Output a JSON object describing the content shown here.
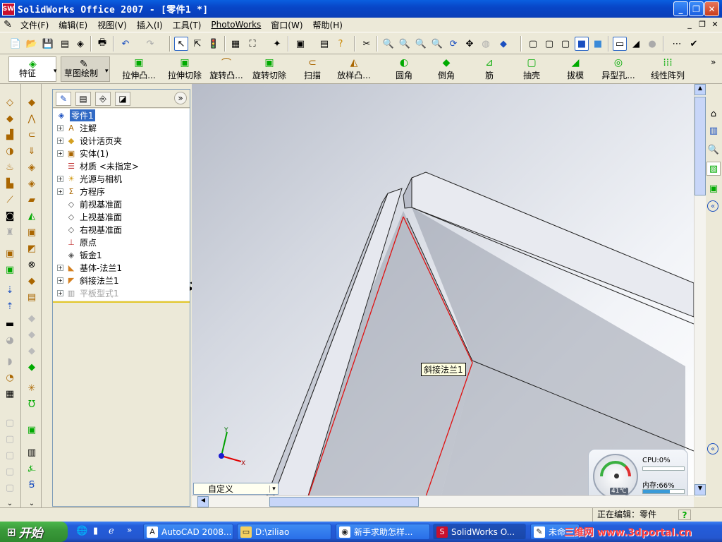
{
  "window": {
    "title": "SolidWorks Office 2007 - [零件1 *]",
    "app_icon": "SW"
  },
  "menu": [
    "文件(F)",
    "编辑(E)",
    "视图(V)",
    "插入(I)",
    "工具(T)",
    "PhotoWorks",
    "窗口(W)",
    "帮助(H)"
  ],
  "feature_toolbar": {
    "tabs": [
      "特征",
      "草图绘制"
    ],
    "items": [
      "拉伸凸...",
      "拉伸切除",
      "旋转凸...",
      "旋转切除",
      "扫描",
      "放样凸...",
      "圆角",
      "倒角",
      "筋",
      "抽壳",
      "拔模",
      "异型孔...",
      "线性阵列"
    ]
  },
  "feature_tree": {
    "root": "零件1",
    "items": [
      {
        "label": "注解",
        "icon": "annotation-icon",
        "expandable": true
      },
      {
        "label": "设计活页夹",
        "icon": "design-binder-icon",
        "expandable": true
      },
      {
        "label": "实体(1)",
        "icon": "solid-bodies-icon",
        "expandable": true
      },
      {
        "label": "材质 <未指定>",
        "icon": "material-icon",
        "expandable": false
      },
      {
        "label": "光源与相机",
        "icon": "lights-camera-icon",
        "expandable": true
      },
      {
        "label": "方程序",
        "icon": "equations-icon",
        "expandable": true
      },
      {
        "label": "前视基准面",
        "icon": "plane-icon",
        "expandable": false
      },
      {
        "label": "上视基准面",
        "icon": "plane-icon",
        "expandable": false
      },
      {
        "label": "右视基准面",
        "icon": "plane-icon",
        "expandable": false
      },
      {
        "label": "原点",
        "icon": "origin-icon",
        "expandable": false
      },
      {
        "label": "钣金1",
        "icon": "sheet-metal-icon",
        "expandable": false
      },
      {
        "label": "基体-法兰1",
        "icon": "base-flange-icon",
        "expandable": true
      },
      {
        "label": "斜接法兰1",
        "icon": "miter-flange-icon",
        "expandable": true
      },
      {
        "label": "平板型式1",
        "icon": "flat-pattern-icon",
        "expandable": true,
        "suppressed": true
      }
    ]
  },
  "graphics": {
    "callout": "斜接法兰1",
    "view_select": "自定义",
    "triad": {
      "x": "X",
      "y": "Y"
    }
  },
  "widget": {
    "cpu": "CPU:0%",
    "memory": "内存:66%",
    "memory_fraction": 0.66,
    "temp": "41℃"
  },
  "status": {
    "editing": "正在编辑：零件",
    "help": "?"
  },
  "taskbar": {
    "start": "开始",
    "tasks": [
      "AutoCAD 2008...",
      "D:\\ziliao",
      "新手求助怎样...",
      "SolidWorks O...",
      "未命"
    ],
    "watermark": "三维网 www.3dportal.cn"
  },
  "colors": {
    "titlebar": "#0a46c8",
    "edge_red": "#e01010",
    "tree_selected": "#316ac5"
  }
}
